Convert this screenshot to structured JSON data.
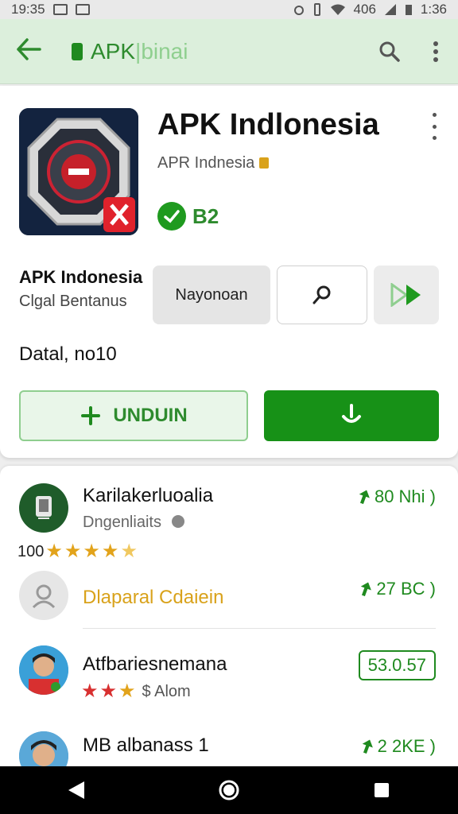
{
  "status_bar": {
    "time_left": "19:35",
    "battery_pct": "406",
    "time_right": "1:36"
  },
  "app_bar": {
    "brand_a": "APK",
    "brand_b": "binai"
  },
  "app": {
    "title": "APK Indlonesia",
    "subtitle": "APR  Indnesia",
    "rating_value": "B2",
    "developer_name": "APK Indonesia",
    "developer_sub": "Clgal Bentanus",
    "chip_label": "Nayonoan",
    "detail_text": "Datal, no10",
    "unduh_label": "UNDUIN"
  },
  "list": {
    "items": [
      {
        "title": "Karilakerluoalia",
        "subtitle": "Dngenliaits",
        "price": "80 Nhi )",
        "stars_count": "100"
      },
      {
        "title": "Dlaparal Cdaiein",
        "price": "27 BC )"
      },
      {
        "title": "Atfbariesnemana",
        "subtitle": "$ Alom",
        "price": "53.0.57"
      },
      {
        "title": "MB albanass  1",
        "price": "2 2KE )"
      }
    ]
  },
  "colors": {
    "accent_green": "#1f8a1f",
    "appbar_bg": "#dcefdc",
    "star_gold": "#e2a31b"
  }
}
